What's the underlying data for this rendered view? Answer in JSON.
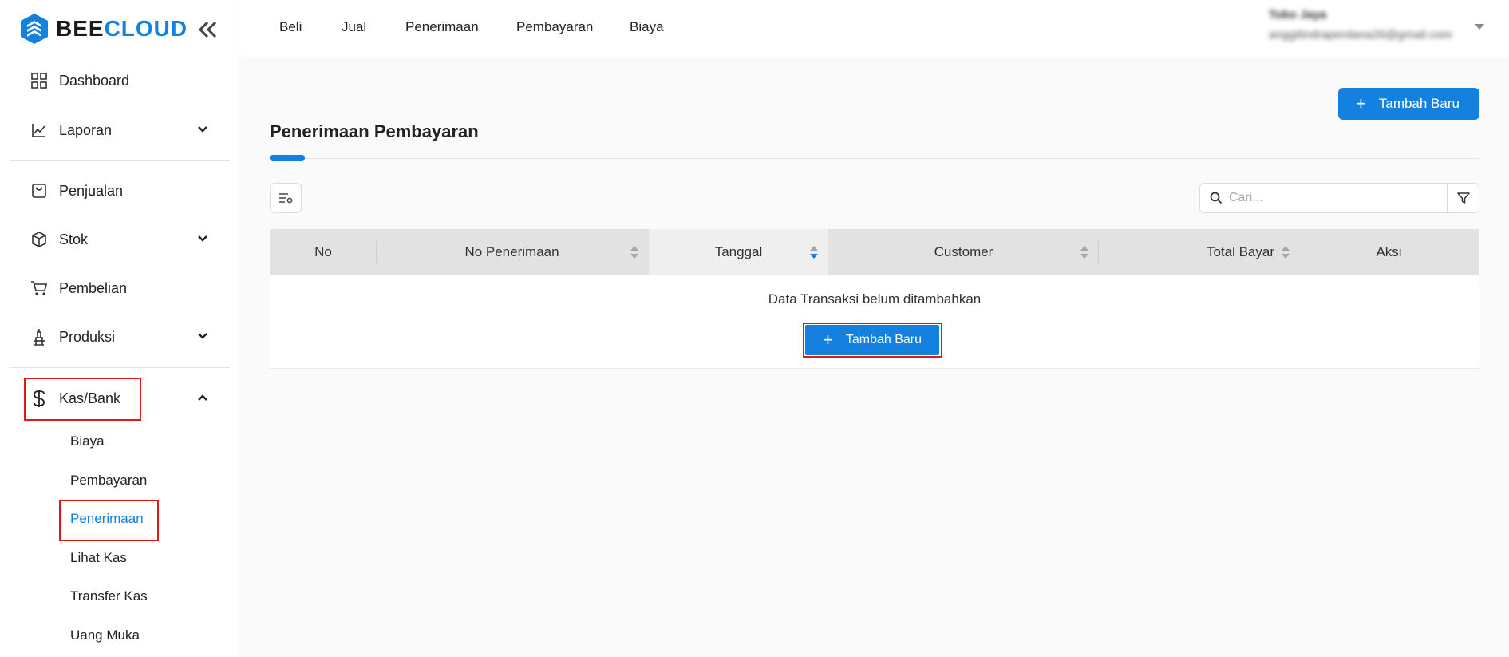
{
  "brand": {
    "part1": "BEE",
    "part2": "CLOUD"
  },
  "sidebar": {
    "items": [
      {
        "label": "Dashboard"
      },
      {
        "label": "Laporan"
      },
      {
        "label": "Penjualan"
      },
      {
        "label": "Stok"
      },
      {
        "label": "Pembelian"
      },
      {
        "label": "Produksi"
      },
      {
        "label": "Kas/Bank"
      }
    ],
    "kas_sub": [
      {
        "label": "Biaya"
      },
      {
        "label": "Pembayaran"
      },
      {
        "label": "Penerimaan"
      },
      {
        "label": "Lihat Kas"
      },
      {
        "label": "Transfer Kas"
      },
      {
        "label": "Uang Muka"
      }
    ]
  },
  "topnav": [
    {
      "label": "Beli"
    },
    {
      "label": "Jual"
    },
    {
      "label": "Penerimaan"
    },
    {
      "label": "Pembayaran"
    },
    {
      "label": "Biaya"
    }
  ],
  "user": {
    "name": "Toko Jaya",
    "email": "anggitindraperdana26@gmail.com"
  },
  "page": {
    "title": "Penerimaan Pembayaran",
    "add_button": "Tambah Baru",
    "search_placeholder": "Cari...",
    "table": {
      "columns": [
        "No",
        "No Penerimaan",
        "Tanggal",
        "Customer",
        "Total Bayar",
        "Aksi"
      ],
      "empty_message": "Data Transaksi belum ditambahkan",
      "empty_add_button": "Tambah Baru"
    }
  },
  "colors": {
    "accent": "#1480e0",
    "highlight": "#e01818"
  },
  "icons": [
    "logo-icon",
    "collapse-icon",
    "dashboard-icon",
    "chart-line-icon",
    "receipt-icon",
    "box-icon",
    "cart-icon",
    "factory-icon",
    "dollar-icon",
    "chevron-down-icon",
    "chevron-up-icon",
    "plus-icon",
    "column-settings-icon",
    "search-icon",
    "filter-icon",
    "sort-icon"
  ]
}
